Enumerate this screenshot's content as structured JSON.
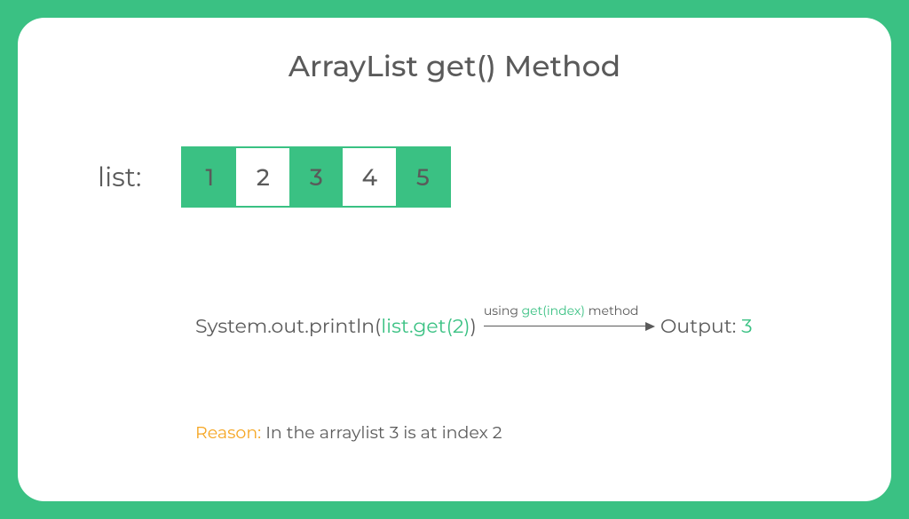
{
  "title": "ArrayList get() Method",
  "listLabel": "list:",
  "array": {
    "cells": [
      {
        "value": "1",
        "bg": "green"
      },
      {
        "value": "2",
        "bg": "white"
      },
      {
        "value": "3",
        "bg": "green"
      },
      {
        "value": "4",
        "bg": "white"
      },
      {
        "value": "5",
        "bg": "green"
      }
    ]
  },
  "code": {
    "prefix": "System.out.println(",
    "highlight": "list.get(2)",
    "suffix": ")",
    "arrowLabel": {
      "pre": "using ",
      "mid": "get(index)",
      "post": " method"
    },
    "outputLabel": "Output: ",
    "outputValue": "3"
  },
  "reason": {
    "label": "Reason: ",
    "text": "In the arraylist 3 is at index 2"
  }
}
